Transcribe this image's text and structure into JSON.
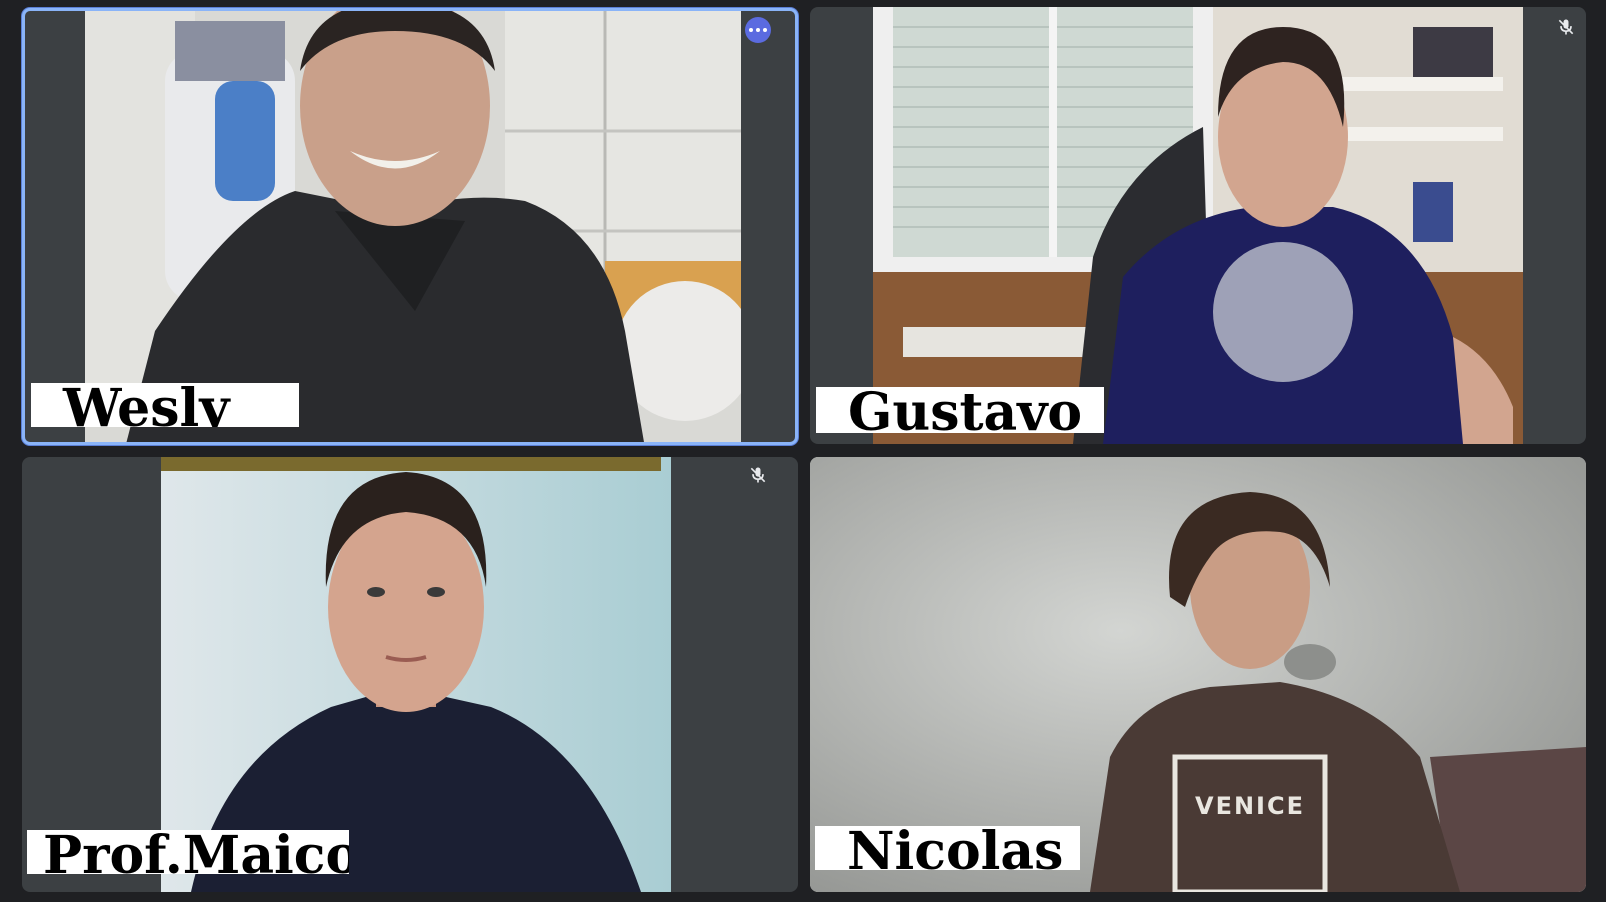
{
  "meeting": {
    "tiles": [
      {
        "name": "Wesly",
        "muted": false,
        "active_speaker": true,
        "more_options_label": "More options"
      },
      {
        "name": "Gustavo",
        "muted": true,
        "active_speaker": false
      },
      {
        "name": "Prof.Maicon",
        "muted": true,
        "active_speaker": false
      },
      {
        "name": "Nicolas",
        "muted": false,
        "active_speaker": false
      }
    ]
  },
  "colors": {
    "background": "#1f2023",
    "tile_bg": "#3c4043",
    "active_border": "#8ab4f8",
    "more_button": "#5b6be0",
    "label_bg": "#ffffff",
    "label_text": "#000000"
  },
  "icons": {
    "more": "more-horizontal-icon",
    "mic_off": "mic-off-icon"
  }
}
